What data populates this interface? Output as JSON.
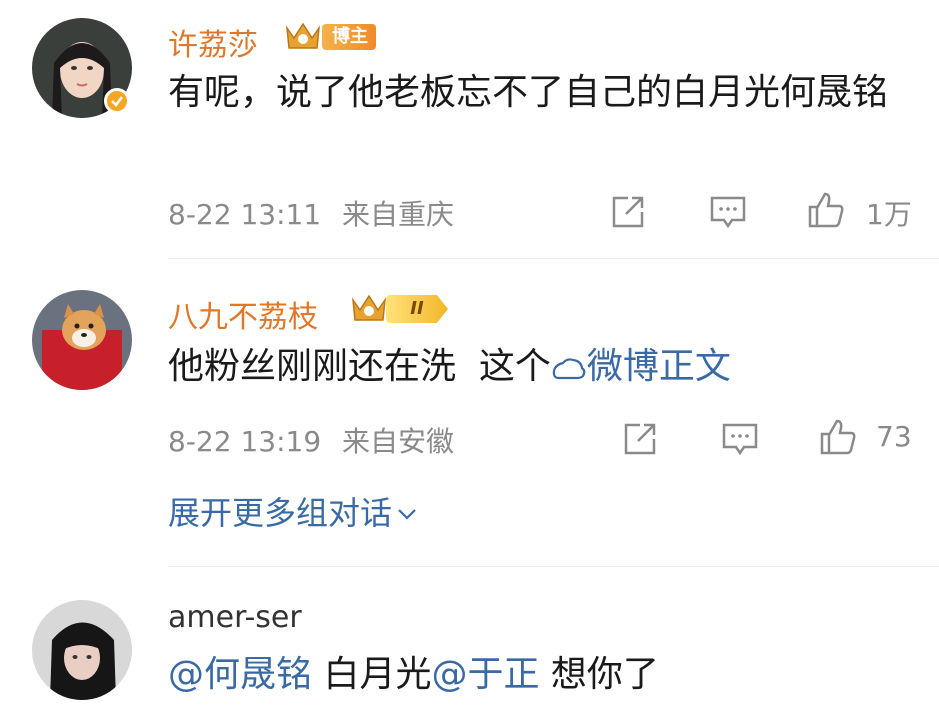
{
  "comments": [
    {
      "author": "许荔莎",
      "badge": "博主",
      "text": "有呢，说了他老板忘不了自己的白月光何晟铭",
      "date": "8-22 13:11",
      "location": "来自重庆",
      "likes": "1万"
    },
    {
      "author": "八九不荔枝",
      "rank": "II",
      "text_before": "他粉丝刚刚还在洗  这个",
      "link_text": "微博正文",
      "date": "8-22 13:19",
      "location": "来自安徽",
      "likes": "73"
    },
    {
      "author": "amer-ser",
      "mention1": "@何晟铭",
      "middle": " 白月光",
      "mention2": "@于正",
      "end": " 想你了"
    }
  ],
  "expand_label": "展开更多组对话",
  "icons": [
    "share-icon",
    "comment-icon",
    "like-icon",
    "verified-icon",
    "crown-icon",
    "chevron-down-icon",
    "weibo-logo-icon"
  ],
  "colors": {
    "name_orange": "#e0782a",
    "link_blue": "#3a6aa5",
    "meta_gray": "#8a8a8a"
  }
}
